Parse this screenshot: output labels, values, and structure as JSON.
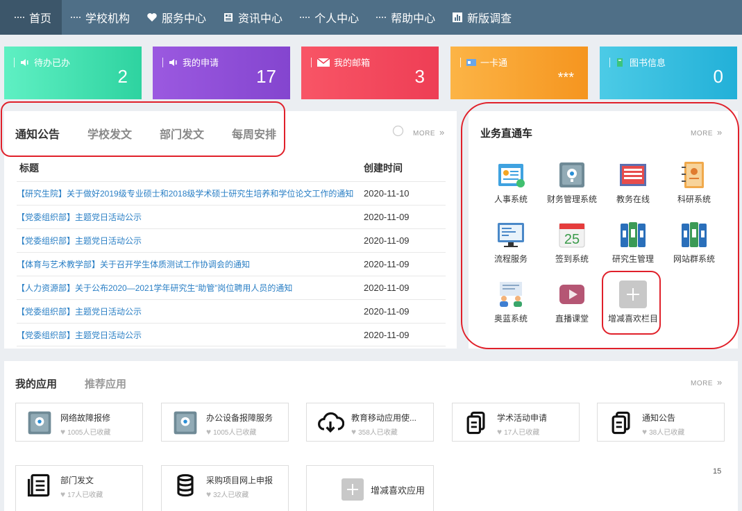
{
  "nav": [
    {
      "label": "首页",
      "icon": "grid-icon",
      "active": true
    },
    {
      "label": "学校机构",
      "icon": "grid-icon"
    },
    {
      "label": "服务中心",
      "icon": "heart-icon"
    },
    {
      "label": "资讯中心",
      "icon": "news-icon"
    },
    {
      "label": "个人中心",
      "icon": "grid-icon"
    },
    {
      "label": "帮助中心",
      "icon": "grid-icon"
    },
    {
      "label": "新版调查",
      "icon": "chart-icon"
    }
  ],
  "cards": [
    {
      "label": "待办已办",
      "value": "2",
      "color": "#3ddba8"
    },
    {
      "label": "我的申请",
      "value": "17",
      "color": "#8f4bd6"
    },
    {
      "label": "我的邮箱",
      "value": "3",
      "color": "#f34a5c"
    },
    {
      "label": "一卡通",
      "value": "***",
      "color": "#f9a532"
    },
    {
      "label": "图书信息",
      "value": "0",
      "color": "#37bde0"
    }
  ],
  "notice": {
    "tabs": [
      "通知公告",
      "学校发文",
      "部门发文",
      "每周安排"
    ],
    "more": "MORE",
    "col_title": "标题",
    "col_date": "创建时间",
    "rows": [
      {
        "title": "【研究生院】关于做好2019级专业硕士和2018级学术硕士研究生培养和学位论文工作的通知",
        "date": "2020-11-10"
      },
      {
        "title": "【党委组织部】主题党日活动公示",
        "date": "2020-11-09"
      },
      {
        "title": "【党委组织部】主题党日活动公示",
        "date": "2020-11-09"
      },
      {
        "title": "【体育与艺术教学部】关于召开学生体质测试工作协调会的通知",
        "date": "2020-11-09"
      },
      {
        "title": "【人力资源部】关于公布2020—2021学年研究生“助管”岗位聘用人员的通知",
        "date": "2020-11-09"
      },
      {
        "title": "【党委组织部】主题党日活动公示",
        "date": "2020-11-09"
      },
      {
        "title": "【党委组织部】主题党日活动公示",
        "date": "2020-11-09"
      }
    ]
  },
  "biz": {
    "title": "业务直通车",
    "more": "MORE",
    "apps": [
      {
        "label": "人事系统",
        "icon": "hr-icon"
      },
      {
        "label": "财务管理系统",
        "icon": "safe-icon"
      },
      {
        "label": "教务在线",
        "icon": "document-icon"
      },
      {
        "label": "科研系统",
        "icon": "notebook-icon"
      },
      {
        "label": "流程服务",
        "icon": "monitor-icon"
      },
      {
        "label": "签到系统",
        "icon": "calendar-icon",
        "day": "25"
      },
      {
        "label": "研究生管理",
        "icon": "binder-icon"
      },
      {
        "label": "网站群系统",
        "icon": "binder-icon"
      },
      {
        "label": "奥蓝系统",
        "icon": "meeting-icon"
      },
      {
        "label": "直播课堂",
        "icon": "play-icon"
      },
      {
        "label": "增减喜欢栏目",
        "icon": "add-icon"
      }
    ]
  },
  "myapps": {
    "tabs": [
      "我的应用",
      "推荐应用"
    ],
    "more": "MORE",
    "items": [
      {
        "name": "网络故障报修",
        "fav": "1005人已收藏",
        "icon": "safe-icon"
      },
      {
        "name": "办公设备报障服务",
        "fav": "1005人已收藏",
        "icon": "safe-icon"
      },
      {
        "name": "教育移动应用使...",
        "fav": "358人已收藏",
        "icon": "cloud-download-icon"
      },
      {
        "name": "学术活动申请",
        "fav": "17人已收藏",
        "icon": "copy-icon"
      },
      {
        "name": "通知公告",
        "fav": "38人已收藏",
        "icon": "copy-icon"
      },
      {
        "name": "部门发文",
        "fav": "17人已收藏",
        "icon": "list-doc-icon"
      },
      {
        "name": "采购项目网上申报",
        "fav": "32人已收藏",
        "icon": "database-icon"
      }
    ],
    "add_label": "增减喜欢应用",
    "page": "15"
  }
}
